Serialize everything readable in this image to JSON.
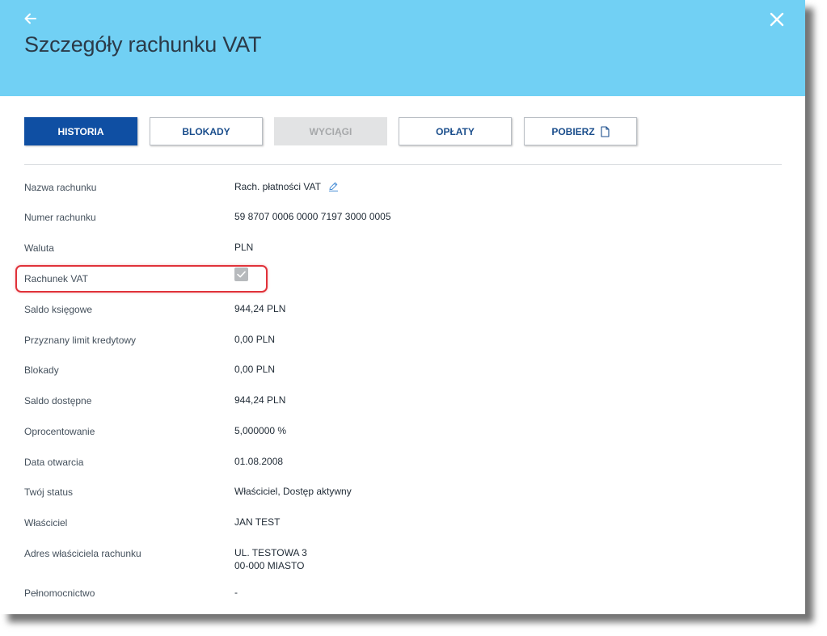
{
  "header": {
    "title": "Szczegóły rachunku VAT",
    "back_icon": "arrow-left-icon",
    "close_icon": "close-icon",
    "background_color": "#71d0f4"
  },
  "toolbar": {
    "buttons": [
      {
        "label": "HISTORIA",
        "state": "active"
      },
      {
        "label": "BLOKADY",
        "state": "normal"
      },
      {
        "label": "WYCIĄGI",
        "state": "disabled"
      },
      {
        "label": "OPŁATY",
        "state": "normal"
      },
      {
        "label": "POBIERZ",
        "state": "normal",
        "icon": "document-icon"
      }
    ],
    "accent_color": "#0f4fa3"
  },
  "details": {
    "account_name": {
      "label": "Nazwa rachunku",
      "value": "Rach. płatności VAT",
      "icon": "pencil-edit-icon"
    },
    "account_number": {
      "label": "Numer rachunku",
      "value": "59 8707 0006 0000 7197 3000 0005"
    },
    "currency": {
      "label": "Waluta",
      "value": "PLN"
    },
    "vat_account": {
      "label": "Rachunek VAT",
      "checked": true,
      "icon": "checkmark-icon"
    },
    "book_balance": {
      "label": "Saldo księgowe",
      "value": "944,24  PLN"
    },
    "credit_limit": {
      "label": "Przyznany limit kredytowy",
      "value": "0,00  PLN"
    },
    "blocks": {
      "label": "Blokady",
      "value": "0,00  PLN"
    },
    "available_balance": {
      "label": "Saldo dostępne",
      "value": "944,24  PLN"
    },
    "interest": {
      "label": "Oprocentowanie",
      "value": "5,000000 %"
    },
    "open_date": {
      "label": "Data otwarcia",
      "value": "01.08.2008"
    },
    "status": {
      "label": "Twój status",
      "value": "Właściciel,  Dostęp aktywny"
    },
    "owner": {
      "label": "Właściciel",
      "value": "JAN TEST"
    },
    "owner_address": {
      "label": "Adres właściciela rachunku",
      "line1": "UL. TESTOWA 3",
      "line2": "00-000 MIASTO"
    },
    "power_of_attorney": {
      "label": "Pełnomocnictwo",
      "value": "-"
    }
  },
  "highlight_color": "#e0323a"
}
